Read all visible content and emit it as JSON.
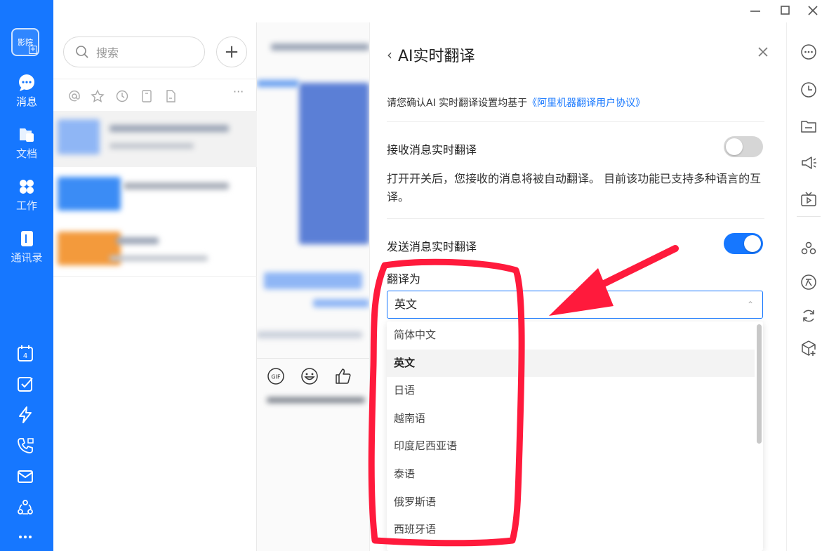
{
  "window": {
    "minimize_icon": "minimize-icon",
    "maximize_icon": "maximize-icon",
    "close_icon": "close-icon"
  },
  "nav": {
    "avatar_text": "影院",
    "items": [
      {
        "label": "消息",
        "icon": "chat-bubble-icon"
      },
      {
        "label": "文档",
        "icon": "document-folder-icon"
      },
      {
        "label": "工作",
        "icon": "grid-apps-icon"
      },
      {
        "label": "通讯录",
        "icon": "contacts-book-icon"
      }
    ],
    "bottom_icons": [
      "calendar-icon",
      "checkbox-icon",
      "lightning-icon",
      "phone-icon",
      "mail-icon",
      "network-icon",
      "more-icon"
    ],
    "calendar_day": "4"
  },
  "convlist": {
    "search_placeholder": "搜索",
    "add_label": "+",
    "more_label": "···"
  },
  "panel": {
    "title": "AI实时翻译",
    "note_prefix": "请您确认AI 实时翻译设置均基于",
    "note_link": "《阿里机器翻译用户协议》",
    "receive_label": "接收消息实时翻译",
    "receive_on": false,
    "receive_desc": "打开开关后，您接收的消息将被自动翻译。 目前该功能已支持多种语言的互译。",
    "send_label": "发送消息实时翻译",
    "send_on": true,
    "translate_to_label": "翻译为",
    "selected_language": "英文",
    "options": [
      "简体中文",
      "英文",
      "日语",
      "越南语",
      "印度尼西亚语",
      "泰语",
      "俄罗斯语",
      "西班牙语"
    ]
  },
  "chat_toolbar": {
    "gif_label": "GIF"
  },
  "colors": {
    "accent": "#1677ff",
    "annotation_red": "#ff1a3c",
    "toggle_off": "#d6d6d6"
  }
}
